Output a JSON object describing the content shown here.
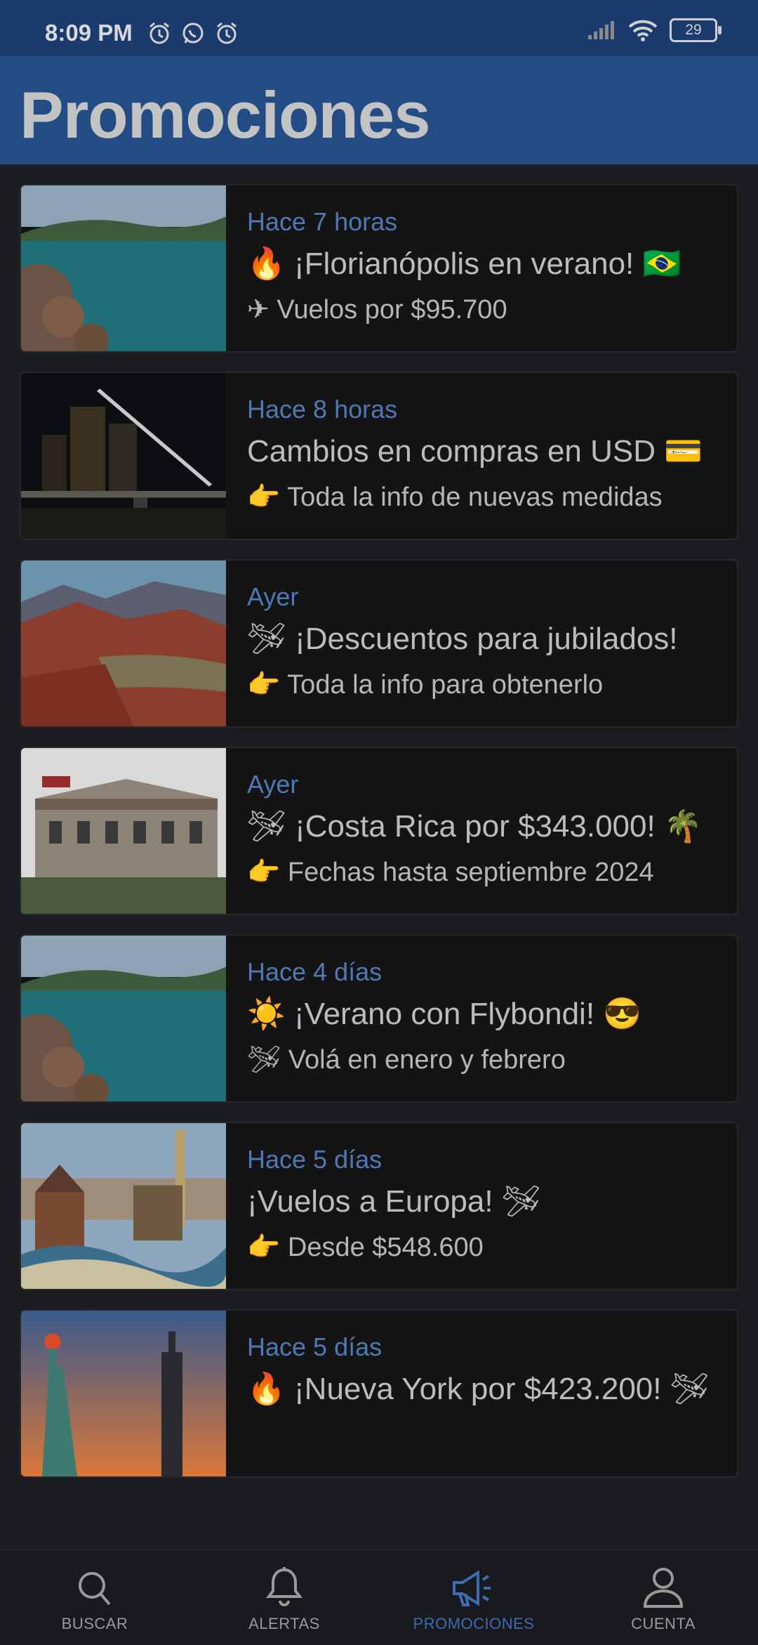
{
  "status": {
    "time": "8:09 PM",
    "battery": "29"
  },
  "header": {
    "title": "Promociones"
  },
  "cards": [
    {
      "time": "Hace 7 horas",
      "title": "🔥 ¡Florianópolis en verano! 🇧🇷",
      "subtitle": "✈ Vuelos por $95.700",
      "image": "lagoon-beach"
    },
    {
      "time": "Hace 8 horas",
      "title": "Cambios en compras en USD 💳",
      "subtitle": "👉 Toda la info de nuevas medidas",
      "image": "night-bridge-city"
    },
    {
      "time": "Ayer",
      "title": "🛩 ¡Descuentos para jubilados!",
      "subtitle": "👉 Toda la info para obtenerlo",
      "image": "red-mountains"
    },
    {
      "time": "Ayer",
      "title": "🛩 ¡Costa Rica por $343.000! 🌴",
      "subtitle": "👉 Fechas hasta septiembre 2024",
      "image": "national-theatre"
    },
    {
      "time": "Hace 4 días",
      "title": "☀️ ¡Verano con Flybondi! 😎",
      "subtitle": "🛩 Volá en enero y febrero",
      "image": "lagoon-beach"
    },
    {
      "time": "Hace 5 días",
      "title": "¡Vuelos a Europa! 🛩",
      "subtitle": "👉 Desde $548.600",
      "image": "park-guell"
    },
    {
      "time": "Hace 5 días",
      "title": "🔥 ¡Nueva York por $423.200! 🛩",
      "subtitle": "",
      "image": "statue-of-liberty"
    }
  ],
  "nav": [
    {
      "label": "BUSCAR",
      "icon": "search-icon"
    },
    {
      "label": "ALERTAS",
      "icon": "bell-icon"
    },
    {
      "label": "PROMOCIONES",
      "icon": "megaphone-icon",
      "active": true
    },
    {
      "label": "CUENTA",
      "icon": "user-icon"
    }
  ],
  "colors": {
    "accent": "#3d6cb5",
    "header": "#234c85",
    "statusbar": "#1b3a6e",
    "time_text": "#4f79b6"
  }
}
